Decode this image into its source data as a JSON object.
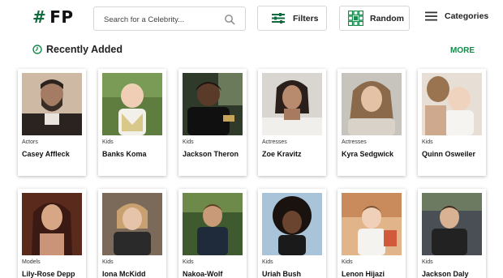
{
  "header": {
    "logo_symbol": "#",
    "logo_text": "FP",
    "search_placeholder": "Search for a Celebrity...",
    "search_icon": "search-icon",
    "filters_label": "Filters",
    "filters_icon": "sliders-icon",
    "random_label": "Random",
    "random_icon": "grid-icon",
    "categories_label": "Categories",
    "categories_icon": "hamburger-menu-icon",
    "brand_color": "#0f6a3d"
  },
  "section": {
    "title": "Recently Added",
    "icon": "clock-icon",
    "more_label": "MORE",
    "more_color": "#138a4c"
  },
  "cards": [
    {
      "category": "Actors",
      "name": "Casey Affleck"
    },
    {
      "category": "Kids",
      "name": "Banks Koma"
    },
    {
      "category": "Kids",
      "name": "Jackson Theron"
    },
    {
      "category": "Actresses",
      "name": "Zoe Kravitz"
    },
    {
      "category": "Actresses",
      "name": "Kyra Sedgwick"
    },
    {
      "category": "Kids",
      "name": "Quinn Osweiler"
    },
    {
      "category": "Models",
      "name": "Lily-Rose Depp"
    },
    {
      "category": "Kids",
      "name": "Iona McKidd"
    },
    {
      "category": "Kids",
      "name": "Nakoa-Wolf"
    },
    {
      "category": "Kids",
      "name": "Uriah Bush"
    },
    {
      "category": "Kids",
      "name": "Lenon Hijazi"
    },
    {
      "category": "Kids",
      "name": "Jackson Daly"
    }
  ]
}
